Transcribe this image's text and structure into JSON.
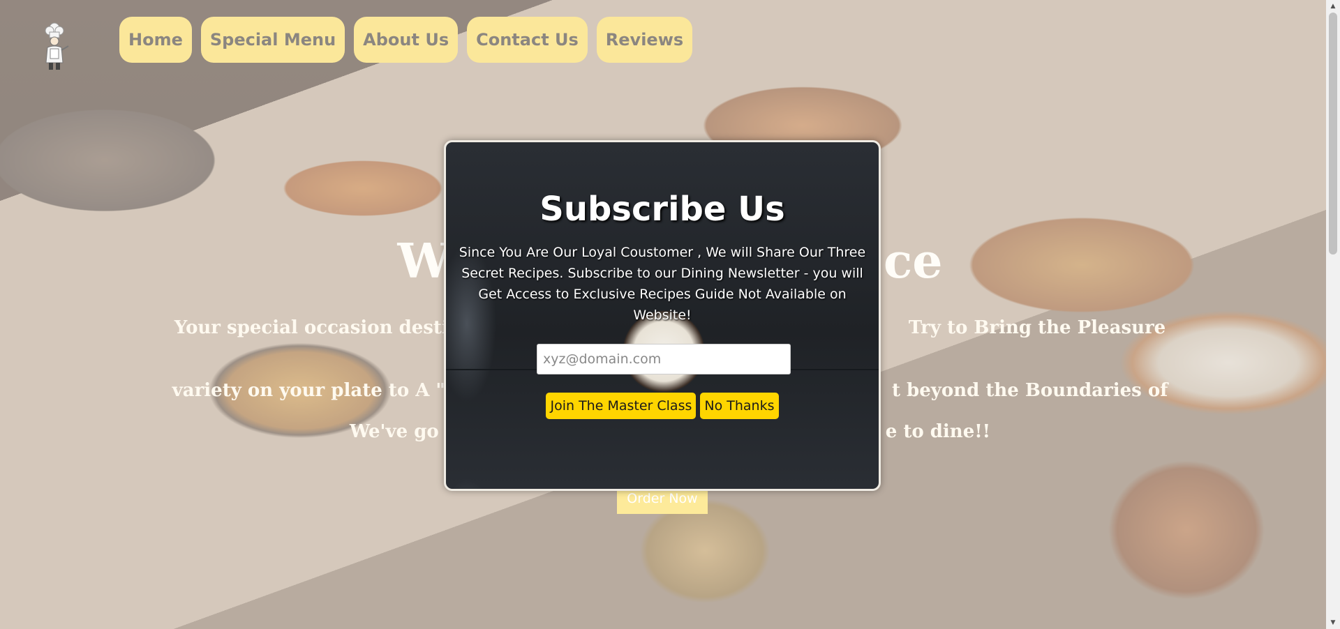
{
  "nav": {
    "items": [
      {
        "label": "Home"
      },
      {
        "label": "Special Menu"
      },
      {
        "label": "About Us"
      },
      {
        "label": "Contact Us"
      },
      {
        "label": "Reviews"
      }
    ]
  },
  "hero": {
    "title_left": "W",
    "title_right": "ce",
    "desc_line1_left": "Your special occasion destin",
    "desc_line1_right": "Try to Bring the Pleasure of",
    "desc_line2_left": "variety on your plate to A \"",
    "desc_line2_right": "t beyond the Boundaries of",
    "tag_left": "We've go",
    "tag_right": "e to dine!!",
    "order_label": "Order Now"
  },
  "modal": {
    "title": "Subscribe Us",
    "text": "Since You Are Our Loyal Coustomer , We will Share Our Three Secret Recipes. Subscribe to our Dining Newsletter - you will Get Access to Exclusive Recipes Guide Not Available on Website!",
    "email_placeholder": "xyz@domain.com",
    "join_label": "Join The Master Class",
    "decline_label": "No Thanks"
  }
}
